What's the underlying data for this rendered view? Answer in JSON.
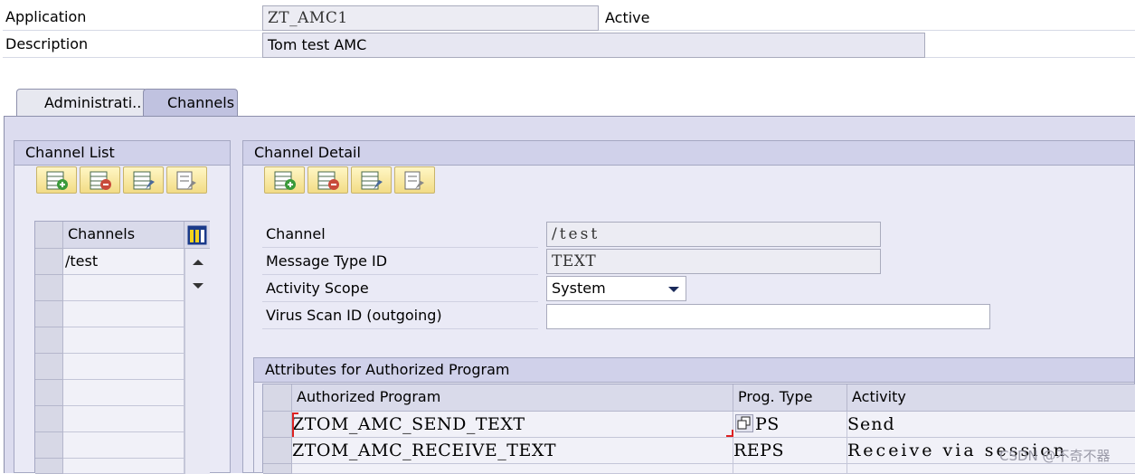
{
  "header": {
    "application_label": "Application",
    "application_value": "ZT_AMC1",
    "application_status": "Active",
    "description_label": "Description",
    "description_value": "Tom test AMC"
  },
  "tabs": [
    {
      "label": "Administrati..."
    },
    {
      "label": "Channels"
    }
  ],
  "channel_list": {
    "title": "Channel List",
    "toolbar": [
      "add-row-icon",
      "delete-row-icon",
      "edit-row-icon",
      "copy-row-icon"
    ],
    "column_header": "Channels",
    "rows": [
      "/test"
    ]
  },
  "channel_detail": {
    "title": "Channel Detail",
    "toolbar": [
      "add-row-icon",
      "delete-row-icon",
      "edit-row-icon",
      "copy-row-icon"
    ],
    "channel_label": "Channel",
    "channel_value": "/test",
    "message_type_label": "Message Type ID",
    "message_type_value": "TEXT",
    "activity_scope_label": "Activity Scope",
    "activity_scope_value": "System",
    "virus_scan_label": "Virus Scan ID (outgoing)",
    "virus_scan_value": ""
  },
  "attributes": {
    "title": "Attributes for Authorized Program",
    "columns": [
      "Authorized Program",
      "Prog. Type",
      "Activity"
    ],
    "rows": [
      {
        "program": "ZTOM_AMC_SEND_TEXT",
        "prog_type": "REPS",
        "prog_type_visible": "PS",
        "activity": "Send"
      },
      {
        "program": "ZTOM_AMC_RECEIVE_TEXT",
        "prog_type": "REPS",
        "prog_type_visible": "REPS",
        "activity": "Receive via session"
      }
    ]
  },
  "watermark": "CSDN @不奇不器"
}
